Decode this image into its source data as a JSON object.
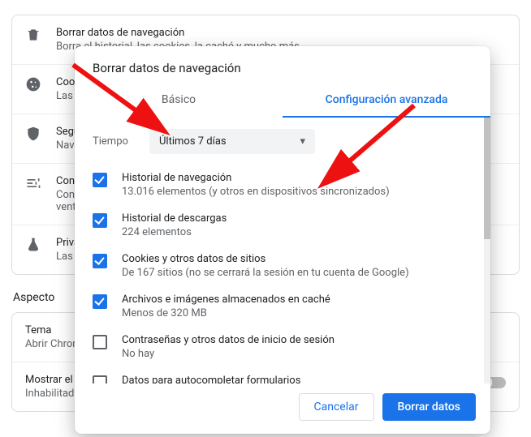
{
  "bg": {
    "rows": [
      {
        "title": "Borrar datos de navegación",
        "sub": "Borra el historial, las cookies, la caché y mucho más"
      },
      {
        "title": "Cookies",
        "sub": "Las cookies están habilitadas"
      },
      {
        "title": "Seguridad",
        "sub": "Navegación segura"
      },
      {
        "title": "Configuración",
        "sub": "Controla la configuración de contenido y permisos para sitios, como imágenes, JavaScript, ventanas emergentes"
      },
      {
        "title": "Privacidad",
        "sub": "Las funciones de privacidad"
      }
    ],
    "section": "Aspecto",
    "theme_title": "Tema",
    "theme_sub": "Abrir Chrome Web Store",
    "show_title": "Mostrar el botón de página principal",
    "show_sub": "Inhabilitado"
  },
  "modal": {
    "title": "Borrar datos de navegación",
    "tabs": {
      "basic": "Básico",
      "advanced": "Configuración avanzada"
    },
    "time_label": "Tiempo",
    "time_value": "Últimos 7 días",
    "items": [
      {
        "checked": true,
        "title": "Historial de navegación",
        "sub": "13.016 elementos (y otros en dispositivos sincronizados)"
      },
      {
        "checked": true,
        "title": "Historial de descargas",
        "sub": "224 elementos"
      },
      {
        "checked": true,
        "title": "Cookies y otros datos de sitios",
        "sub": "De 167 sitios (no se cerrará la sesión en tu cuenta de Google)"
      },
      {
        "checked": true,
        "title": "Archivos e imágenes almacenados en caché",
        "sub": "Menos de 320 MB"
      },
      {
        "checked": false,
        "title": "Contraseñas y otros datos de inicio de sesión",
        "sub": "No hay"
      },
      {
        "checked": false,
        "title": "Datos para autocompletar formularios",
        "sub": ""
      }
    ],
    "cancel": "Cancelar",
    "confirm": "Borrar datos"
  }
}
